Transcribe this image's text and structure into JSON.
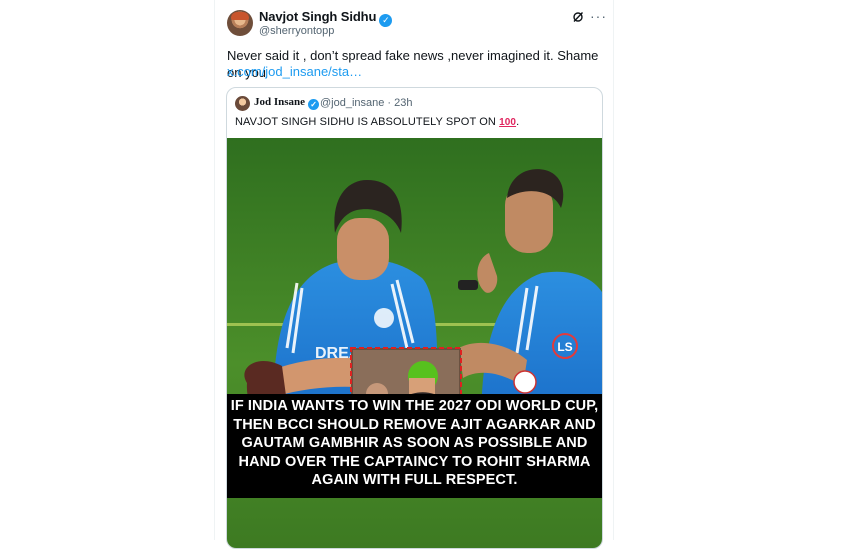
{
  "tweet": {
    "author_name": "Navjot Singh Sidhu",
    "author_handle": "@sherryontopp",
    "text": "Never said it , don’t spread fake news ,never imagined it. Shame on you",
    "link": "x.com/jod_insane/sta…",
    "verified_mark": "✓",
    "more_label": "···"
  },
  "quote": {
    "author_name": "Jod Insane",
    "author_handle": "@jod_insane · 23h",
    "text": "NAVJOT SINGH SIDHU IS ABSOLUTELY SPOT ON",
    "emoji": "100",
    "text_end": "."
  },
  "image": {
    "jersey_text": "DREA",
    "watermark": "LS",
    "caption_lines": [
      "IF INDIA WANTS TO WIN THE 2027 ODI WORLD CUP,",
      "THEN BCCI SHOULD REMOVE AJIT AGARKAR AND",
      "GAUTAM GAMBHIR AS SOON AS POSSIBLE AND",
      "HAND OVER THE CAPTAINCY TO ROHIT SHARMA",
      "AGAIN WITH FULL RESPECT."
    ]
  },
  "colors": {
    "accent": "#1d9bf0",
    "secondary_text": "#536471",
    "border": "#cfd9de"
  },
  "icons": {
    "verified": "verified-badge-icon",
    "grok": "grok-icon",
    "more": "more-icon"
  }
}
